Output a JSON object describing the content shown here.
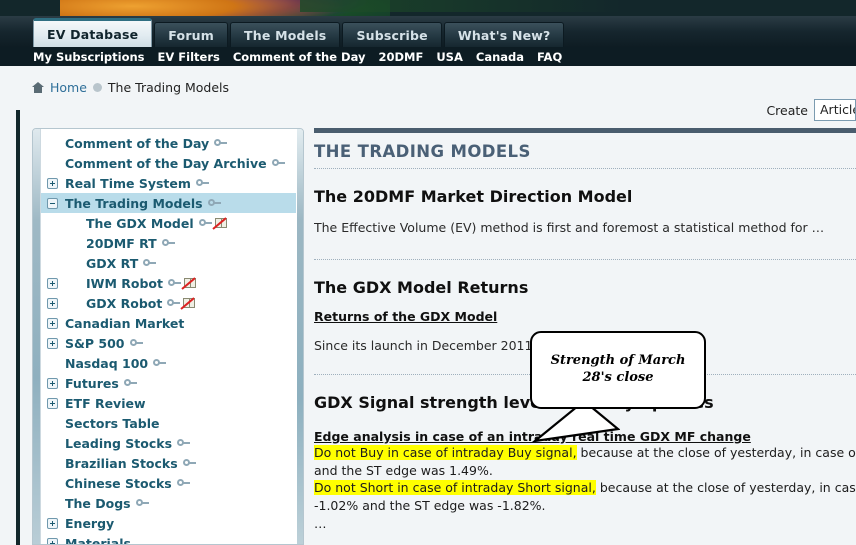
{
  "banner": {
    "name": "site-banner"
  },
  "tabs": [
    {
      "label": "EV Database",
      "active": true
    },
    {
      "label": "Forum",
      "active": false
    },
    {
      "label": "The Models",
      "active": false
    },
    {
      "label": "Subscribe",
      "active": false
    },
    {
      "label": "What's New?",
      "active": false
    }
  ],
  "subnav": [
    {
      "label": "My Subscriptions"
    },
    {
      "label": "EV Filters"
    },
    {
      "label": "Comment of the Day"
    },
    {
      "label": "20DMF"
    },
    {
      "label": "USA"
    },
    {
      "label": "Canada"
    },
    {
      "label": "FAQ"
    }
  ],
  "breadcrumb": {
    "home_label": "Home",
    "current_label": "The Trading Models"
  },
  "create": {
    "label": "Create",
    "selected": "Article"
  },
  "sidebar": {
    "items": [
      {
        "label": "Comment of the Day",
        "indent": 1,
        "toggle": "none",
        "key": true,
        "book": false,
        "selected": false
      },
      {
        "label": "Comment of the Day Archive",
        "indent": 1,
        "toggle": "none",
        "key": true,
        "book": false,
        "selected": false
      },
      {
        "label": "Real Time System",
        "indent": 1,
        "toggle": "plus",
        "key": true,
        "book": false,
        "selected": false
      },
      {
        "label": "The Trading Models",
        "indent": 1,
        "toggle": "minus",
        "key": true,
        "book": false,
        "selected": true
      },
      {
        "label": "The GDX Model",
        "indent": 2,
        "toggle": "none",
        "key": true,
        "book": true,
        "selected": false
      },
      {
        "label": "20DMF RT",
        "indent": 2,
        "toggle": "none",
        "key": true,
        "book": false,
        "selected": false
      },
      {
        "label": "GDX RT",
        "indent": 2,
        "toggle": "none",
        "key": true,
        "book": false,
        "selected": false
      },
      {
        "label": "IWM Robot",
        "indent": 2,
        "toggle": "plus",
        "key": true,
        "book": true,
        "selected": false
      },
      {
        "label": "GDX Robot",
        "indent": 2,
        "toggle": "plus",
        "key": true,
        "book": true,
        "selected": false
      },
      {
        "label": "Canadian Market",
        "indent": 1,
        "toggle": "plus",
        "key": false,
        "book": false,
        "selected": false
      },
      {
        "label": "S&P 500",
        "indent": 1,
        "toggle": "plus",
        "key": true,
        "book": false,
        "selected": false
      },
      {
        "label": "Nasdaq 100",
        "indent": 1,
        "toggle": "none",
        "key": true,
        "book": false,
        "selected": false
      },
      {
        "label": "Futures",
        "indent": 1,
        "toggle": "plus",
        "key": true,
        "book": false,
        "selected": false
      },
      {
        "label": "ETF Review",
        "indent": 1,
        "toggle": "plus",
        "key": false,
        "book": false,
        "selected": false
      },
      {
        "label": "Sectors Table",
        "indent": 1,
        "toggle": "none",
        "key": false,
        "book": false,
        "selected": false
      },
      {
        "label": "Leading Stocks",
        "indent": 1,
        "toggle": "none",
        "key": true,
        "book": false,
        "selected": false
      },
      {
        "label": "Brazilian Stocks",
        "indent": 1,
        "toggle": "none",
        "key": true,
        "book": false,
        "selected": false
      },
      {
        "label": "Chinese Stocks",
        "indent": 1,
        "toggle": "none",
        "key": true,
        "book": false,
        "selected": false
      },
      {
        "label": "The Dogs",
        "indent": 1,
        "toggle": "none",
        "key": true,
        "book": false,
        "selected": false
      },
      {
        "label": "Energy",
        "indent": 1,
        "toggle": "plus",
        "key": false,
        "book": false,
        "selected": false
      },
      {
        "label": "Materials",
        "indent": 1,
        "toggle": "plus",
        "key": false,
        "book": false,
        "selected": false
      }
    ]
  },
  "main": {
    "section_title": "THE TRADING MODELS",
    "block1": {
      "heading": "The 20DMF Market Direction Model",
      "paragraph": "The Effective Volume (EV) method is first and foremost a statistical method for …"
    },
    "block2": {
      "heading": "The GDX Model Returns",
      "link": "Returns of the GDX Model",
      "paragraph": "Since its launch in December 2011, as o"
    },
    "block3": {
      "heading": "GDX Signal strength level and daily updates",
      "subheading": "Edge analysis in case of an intraday real time GDX MF change",
      "line1_hl": "Do not Buy in case of intraday Buy signal,",
      "line1_rest": " because at the close of yesterday, in case of a Buy signal",
      "line2": "and the ST edge was 1.49%.",
      "line3_hl": "Do not Short in case of intraday Short signal,",
      "line3_rest": " because at the close of yesterday, in case of a Short",
      "line4": "-1.02% and the ST edge was -1.82%.",
      "line5": "…"
    }
  },
  "callout": {
    "text": "Strength of March 28's close"
  },
  "colors": {
    "accent_dark": "#13272b",
    "sidebar_link": "#1b5a70",
    "selected_row": "#b9dcea",
    "highlight": "#ffff00",
    "section_title": "#4a6076"
  }
}
